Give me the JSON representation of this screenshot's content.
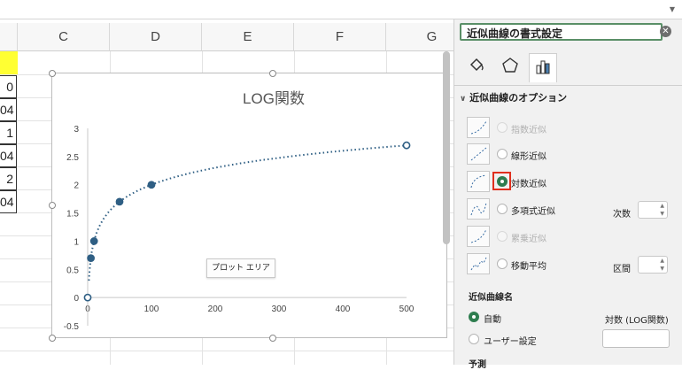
{
  "grid": {
    "columns": [
      "C",
      "D",
      "E",
      "F",
      "G"
    ],
    "left_values": [
      "0",
      "04",
      "1",
      "04",
      "2",
      "04"
    ]
  },
  "chart": {
    "tooltip": "プロット エリア"
  },
  "chart_data": {
    "type": "scatter",
    "title": "LOG関数",
    "x": [
      0,
      5,
      10,
      50,
      100,
      500
    ],
    "y": [
      0,
      0.699,
      1,
      1.699,
      2,
      2.699
    ],
    "trendline": "logarithmic",
    "xlim": [
      0,
      500
    ],
    "ylim": [
      -0.5,
      3
    ],
    "x_ticks": [
      "0",
      "100",
      "200",
      "300",
      "400",
      "500"
    ],
    "y_ticks": [
      "3",
      "2.5",
      "2",
      "1.5",
      "1",
      "0.5",
      "0",
      "-0.5"
    ],
    "colors": {
      "series": "#2f5f84"
    },
    "grid": false
  },
  "panel": {
    "title": "近似曲線の書式設定",
    "section": "近似曲線のオプション",
    "options": [
      {
        "label": "指数近似",
        "disabled": true,
        "selected": false
      },
      {
        "label": "線形近似",
        "disabled": false,
        "selected": false
      },
      {
        "label": "対数近似",
        "disabled": false,
        "selected": true
      },
      {
        "label": "多項式近似",
        "disabled": false,
        "selected": false
      },
      {
        "label": "累乗近似",
        "disabled": true,
        "selected": false
      },
      {
        "label": "移動平均",
        "disabled": false,
        "selected": false
      }
    ],
    "order_label": "次数",
    "period_label": "区間",
    "name_section": "近似曲線名",
    "auto_label": "自動",
    "auto_value": "対数 (LOG関数)",
    "custom_label": "ユーザー設定",
    "forecast_section": "予測"
  },
  "colors": {
    "accent": "#2e7d4f",
    "highlight": "#e0301e"
  }
}
